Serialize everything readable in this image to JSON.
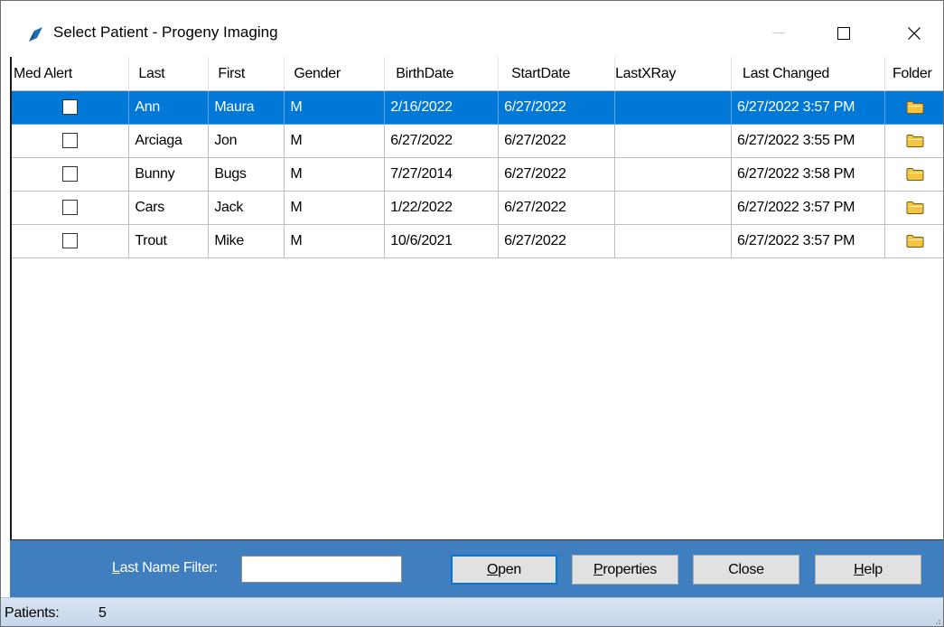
{
  "window": {
    "title": "Select Patient - Progeny Imaging",
    "icons": {
      "app": "progeny-logo-icon",
      "minimize": "minimize-icon",
      "maximize": "maximize-icon",
      "close": "close-icon"
    }
  },
  "grid": {
    "columns": [
      "Med Alert",
      "Last",
      "First",
      "Gender",
      "BirthDate",
      "StartDate",
      "LastXRay",
      "Last Changed",
      "Folder"
    ],
    "rows": [
      {
        "med_alert": false,
        "last": "Ann",
        "first": "Maura",
        "gender": "M",
        "birth_date": "2/16/2022",
        "start_date": "6/27/2022",
        "last_xray": "",
        "last_changed": "6/27/2022 3:57 PM",
        "folder_icon": "folder-icon",
        "selected": true
      },
      {
        "med_alert": false,
        "last": "Arciaga",
        "first": "Jon",
        "gender": "M",
        "birth_date": "6/27/2022",
        "start_date": "6/27/2022",
        "last_xray": "",
        "last_changed": "6/27/2022 3:55 PM",
        "folder_icon": "folder-icon",
        "selected": false
      },
      {
        "med_alert": false,
        "last": "Bunny",
        "first": "Bugs",
        "gender": "M",
        "birth_date": "7/27/2014",
        "start_date": "6/27/2022",
        "last_xray": "",
        "last_changed": "6/27/2022 3:58 PM",
        "folder_icon": "folder-icon",
        "selected": false
      },
      {
        "med_alert": false,
        "last": "Cars",
        "first": "Jack",
        "gender": "M",
        "birth_date": "1/22/2022",
        "start_date": "6/27/2022",
        "last_xray": "",
        "last_changed": "6/27/2022 3:57 PM",
        "folder_icon": "folder-icon",
        "selected": false
      },
      {
        "med_alert": false,
        "last": "Trout",
        "first": "Mike",
        "gender": "M",
        "birth_date": "10/6/2021",
        "start_date": "6/27/2022",
        "last_xray": "",
        "last_changed": "6/27/2022 3:57 PM",
        "folder_icon": "folder-icon",
        "selected": false
      }
    ]
  },
  "filter": {
    "label_mnemonic": "L",
    "label_rest": "ast Name Filter:",
    "value": ""
  },
  "buttons": {
    "open": {
      "mnemonic": "O",
      "rest": "pen"
    },
    "properties": {
      "mnemonic": "P",
      "rest": "roperties"
    },
    "close": {
      "label": "Close"
    },
    "help": {
      "mnemonic": "H",
      "rest": "elp"
    }
  },
  "status": {
    "label": "Patients:",
    "count": "5"
  },
  "colors": {
    "selection": "#0078d7",
    "panel": "#3f7fbf",
    "status_bar": "#cfdded",
    "folder": "#f5c542"
  }
}
